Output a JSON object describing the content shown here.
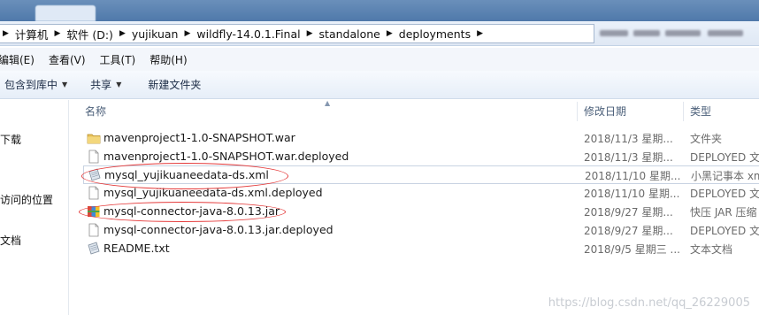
{
  "address": {
    "crumbs": [
      "计算机",
      "软件 (D:)",
      "yujikuan",
      "wildfly-14.0.1.Final",
      "standalone",
      "deployments"
    ]
  },
  "menu": {
    "items": [
      "编辑(E)",
      "查看(V)",
      "工具(T)",
      "帮助(H)"
    ]
  },
  "toolbar": {
    "include_library": "包含到库中",
    "share": "共享",
    "new_folder": "新建文件夹"
  },
  "nav": {
    "items": [
      "下载",
      "访问的位置",
      "文档"
    ]
  },
  "columns": {
    "name": "名称",
    "modified": "修改日期",
    "type": "类型"
  },
  "files": [
    {
      "name": "mavenproject1-1.0-SNAPSHOT.war",
      "date": "2018/11/3 星期...",
      "type": "文件夹",
      "icon": "folder-icon"
    },
    {
      "name": "mavenproject1-1.0-SNAPSHOT.war.deployed",
      "date": "2018/11/3 星期...",
      "type": "DEPLOYED 文件",
      "icon": "blank-file-icon"
    },
    {
      "name": "mysql_yujikuaneedata-ds.xml",
      "date": "2018/11/10 星期...",
      "type": "小黑记事本 xml",
      "icon": "text-file-icon"
    },
    {
      "name": "mysql_yujikuaneedata-ds.xml.deployed",
      "date": "2018/11/10 星期...",
      "type": "DEPLOYED 文件",
      "icon": "blank-file-icon"
    },
    {
      "name": "mysql-connector-java-8.0.13.jar",
      "date": "2018/9/27 星期...",
      "type": "快压 JAR 压缩",
      "icon": "archive-icon"
    },
    {
      "name": "mysql-connector-java-8.0.13.jar.deployed",
      "date": "2018/9/27 星期...",
      "type": "DEPLOYED 文件",
      "icon": "blank-file-icon"
    },
    {
      "name": "README.txt",
      "date": "2018/9/5 星期三 ...",
      "type": "文本文档",
      "icon": "text-file-icon"
    }
  ],
  "watermark": "https://blog.csdn.net/qq_26229005",
  "colors": {
    "annotation": "#e43a3a",
    "folder": "#e8c25a"
  }
}
